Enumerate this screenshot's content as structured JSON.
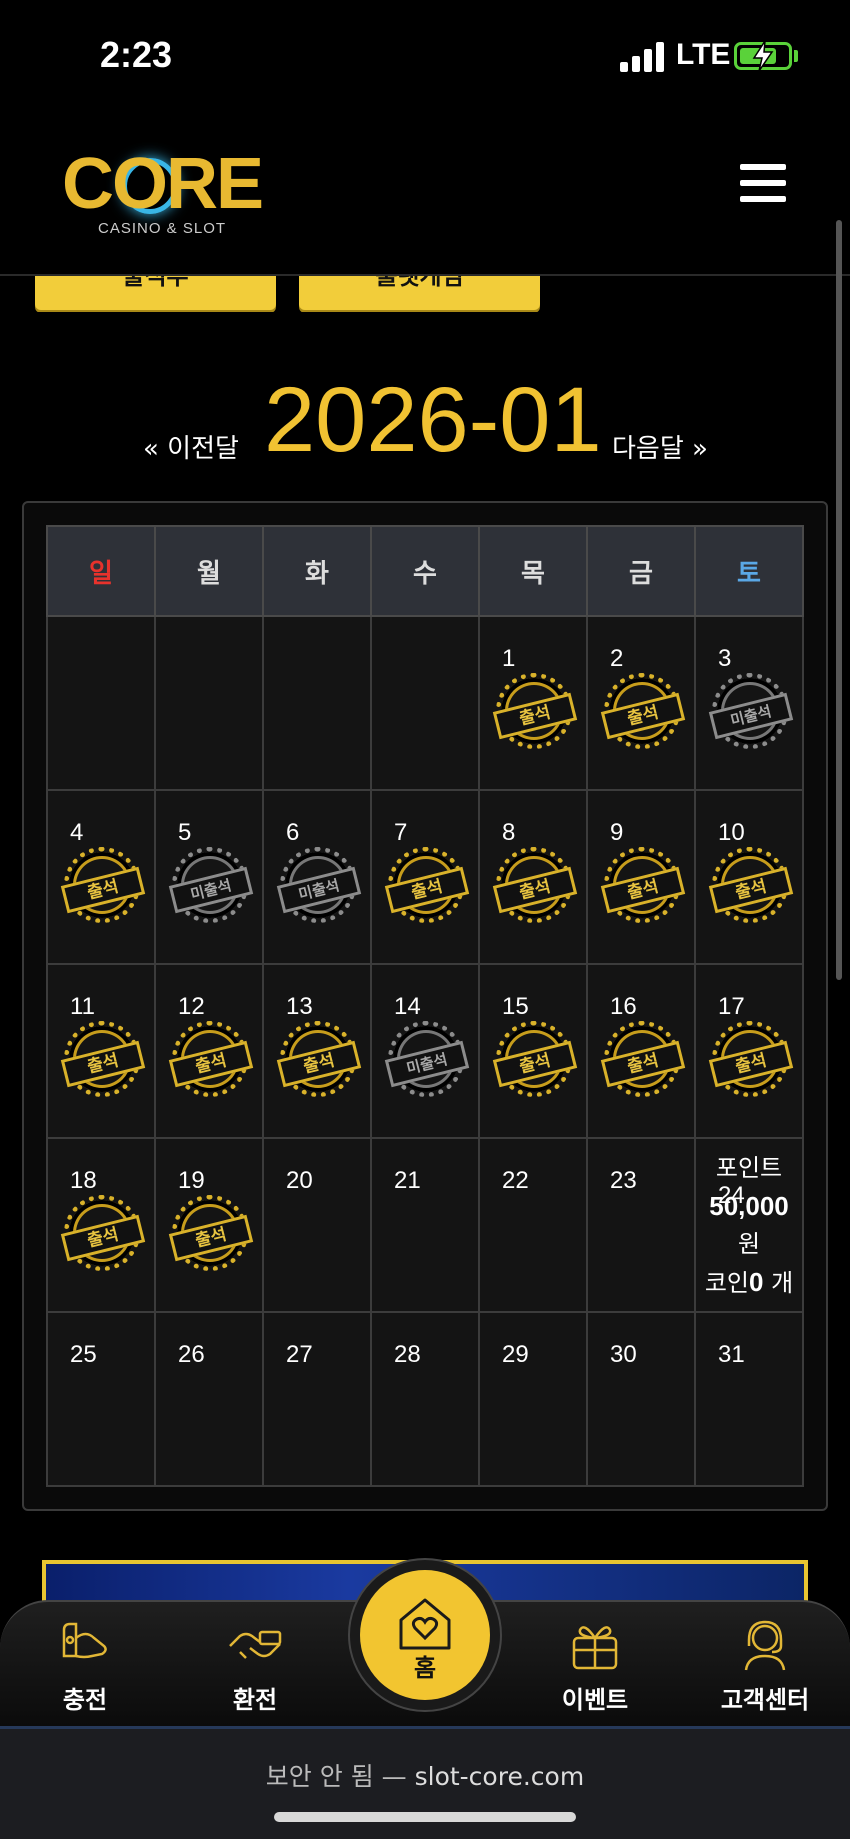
{
  "status_bar": {
    "time": "2:23",
    "network": "LTE"
  },
  "header": {
    "logo_text": "CORE",
    "logo_subtitle": "CASINO & SLOT"
  },
  "top_buttons": [
    "출석부",
    "룰렛게임"
  ],
  "month_nav": {
    "prev": "« 이전달",
    "title": "2026-01",
    "next": "다음달 »"
  },
  "calendar": {
    "weekdays": [
      "일",
      "월",
      "화",
      "수",
      "목",
      "금",
      "토"
    ],
    "weeks": [
      [
        {
          "day": "",
          "status": ""
        },
        {
          "day": "",
          "status": ""
        },
        {
          "day": "",
          "status": ""
        },
        {
          "day": "",
          "status": ""
        },
        {
          "day": "1",
          "status": "출석"
        },
        {
          "day": "2",
          "status": "출석"
        },
        {
          "day": "3",
          "status": "미출석"
        }
      ],
      [
        {
          "day": "4",
          "status": "출석"
        },
        {
          "day": "5",
          "status": "미출석"
        },
        {
          "day": "6",
          "status": "미출석"
        },
        {
          "day": "7",
          "status": "출석"
        },
        {
          "day": "8",
          "status": "출석"
        },
        {
          "day": "9",
          "status": "출석"
        },
        {
          "day": "10",
          "status": "출석"
        }
      ],
      [
        {
          "day": "11",
          "status": "출석"
        },
        {
          "day": "12",
          "status": "출석"
        },
        {
          "day": "13",
          "status": "출석"
        },
        {
          "day": "14",
          "status": "미출석"
        },
        {
          "day": "15",
          "status": "출석"
        },
        {
          "day": "16",
          "status": "출석"
        },
        {
          "day": "17",
          "status": "출석"
        }
      ],
      [
        {
          "day": "18",
          "status": "출석"
        },
        {
          "day": "19",
          "status": "출석"
        },
        {
          "day": "20",
          "status": ""
        },
        {
          "day": "21",
          "status": ""
        },
        {
          "day": "22",
          "status": ""
        },
        {
          "day": "23",
          "status": ""
        },
        {
          "day": "24",
          "status": "reward"
        }
      ],
      [
        {
          "day": "25",
          "status": ""
        },
        {
          "day": "26",
          "status": ""
        },
        {
          "day": "27",
          "status": ""
        },
        {
          "day": "28",
          "status": ""
        },
        {
          "day": "29",
          "status": ""
        },
        {
          "day": "30",
          "status": ""
        },
        {
          "day": "31",
          "status": ""
        }
      ]
    ],
    "reward": {
      "line1": "포인트",
      "amount": "50,000",
      "unit": "원",
      "coin_prefix": "코인",
      "coin_count": "0",
      "coin_unit": " 개"
    }
  },
  "bottom_nav": {
    "items": [
      {
        "label": "충전",
        "icon": "deposit-icon"
      },
      {
        "label": "환전",
        "icon": "withdraw-icon"
      },
      {
        "label": "홈",
        "icon": "home-heart-icon"
      },
      {
        "label": "이벤트",
        "icon": "gift-icon"
      },
      {
        "label": "고객센터",
        "icon": "support-icon"
      }
    ]
  },
  "browser": {
    "insecure_label": "보안 안 됨 —",
    "url": "slot-core.com"
  },
  "colors": {
    "accent": "#f2c530",
    "sunday": "#e8322c",
    "saturday": "#5aa8e6",
    "background": "#000000"
  }
}
